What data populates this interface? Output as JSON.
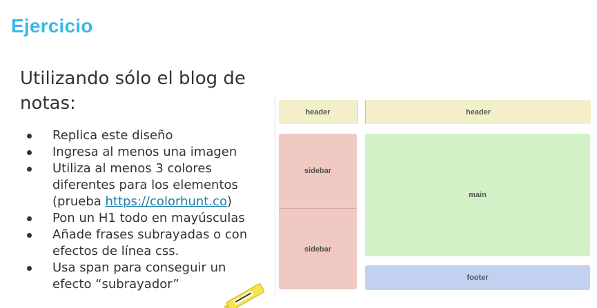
{
  "slide": {
    "title": "Ejercicio",
    "intro": "Utilizando sólo el blog de notas:",
    "bullets": {
      "b1": "Replica este diseño",
      "b2": "Ingresa al menos una imagen",
      "b3_text": "Utiliza al menos 3 colores diferentes para los elementos",
      "b3_open": "(prueba ",
      "b3_link": "https://colorhunt.co",
      "b3_close": ")",
      "b4": "Pon un H1 todo en mayúsculas",
      "b5": "Añade frases subrayadas o con efectos de línea css.",
      "b6": "Usa span para conseguir un efecto “subrayador”"
    }
  },
  "diagram": {
    "header_left": "header",
    "header_right": "header",
    "sidebar_top": "sidebar",
    "sidebar_bottom": "sidebar",
    "main": "main",
    "footer": "footer"
  },
  "colors": {
    "title": "#39b6ea",
    "header": "#f3efc8",
    "sidebar": "#f0c9c3",
    "main": "#d3f1c6",
    "footer": "#c3d1f0",
    "link": "#1a7fa6"
  },
  "icons": {
    "marker": "highlighter-pen-icon"
  }
}
